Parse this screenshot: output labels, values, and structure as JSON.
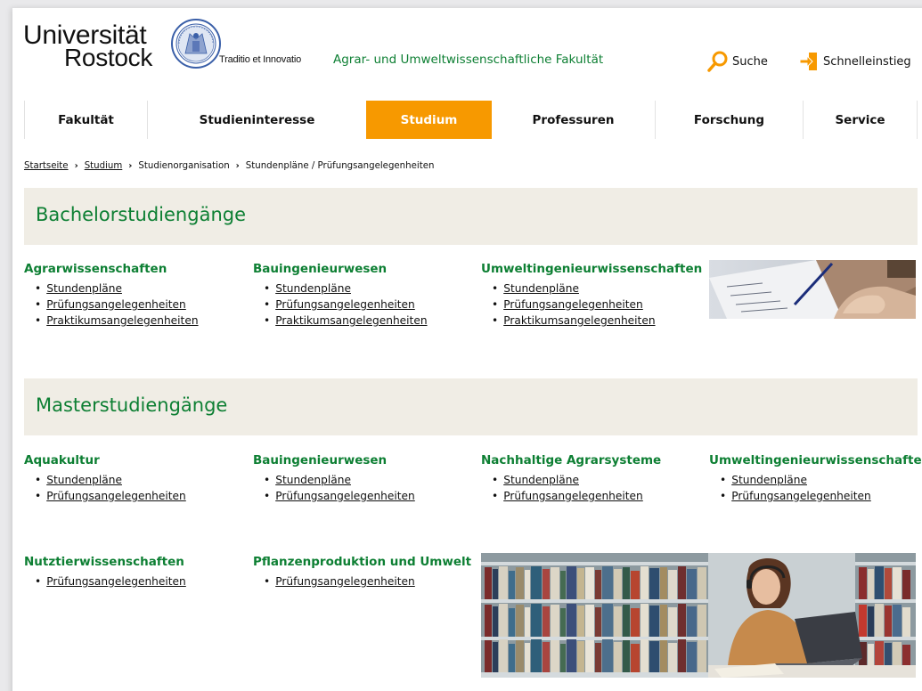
{
  "header": {
    "logo_line1": "Universität",
    "logo_line2": "Rostock",
    "motto": "Traditio et Innovatio",
    "faculty": "Agrar- und Umweltwissenschaftliche Fakultät",
    "search_label": "Suche",
    "quick_label": "Schnelleinstieg",
    "accent_color": "#f79900",
    "green_color": "#0d7f33"
  },
  "nav": {
    "items": [
      {
        "label": "Fakultät"
      },
      {
        "label": "Studieninteresse"
      },
      {
        "label": "Studium",
        "active": true
      },
      {
        "label": "Professuren"
      },
      {
        "label": "Forschung"
      },
      {
        "label": "Service"
      }
    ]
  },
  "breadcrumb": {
    "items": [
      "Startseite",
      "Studium",
      "Studienorganisation",
      "Stundenpläne / Prüfungsangelegenheiten"
    ]
  },
  "bachelor": {
    "title": "Bachelorstudiengänge",
    "columns": [
      {
        "title": "Agrarwissenschaften",
        "links": [
          "Stundenpläne",
          "Prüfungsangelegenheiten",
          "Praktikumsangelegenheiten"
        ]
      },
      {
        "title": "Bauingenieurwesen",
        "links": [
          "Stundenpläne",
          "Prüfungsangelegenheiten",
          "Praktikumsangelegenheiten"
        ]
      },
      {
        "title": "Umweltingenieurwissenschaften",
        "links": [
          "Stundenpläne",
          "Prüfungsangelegenheiten",
          "Praktikumsangelegenheiten"
        ]
      }
    ]
  },
  "master": {
    "title": "Masterstudiengänge",
    "columns": [
      {
        "title": "Aquakultur",
        "links": [
          "Stundenpläne",
          "Prüfungsangelegenheiten"
        ]
      },
      {
        "title": "Bauingenieurwesen",
        "links": [
          "Stundenpläne",
          "Prüfungsangelegenheiten"
        ]
      },
      {
        "title": "Nachhaltige Agrarsysteme",
        "links": [
          "Stundenpläne",
          "Prüfungsangelegenheiten"
        ]
      },
      {
        "title": "Umweltingenieurwissenschaften",
        "links": [
          "Stundenpläne",
          "Prüfungsangelegenheiten"
        ]
      },
      {
        "title": "Nutztierwissenschaften",
        "links": [
          "Prüfungsangelegenheiten"
        ]
      },
      {
        "title": "Pflanzenproduktion und Umwelt",
        "links": [
          "Prüfungsangelegenheiten"
        ]
      }
    ]
  },
  "icons": {
    "search": "search-icon",
    "quick": "quick-access-icon",
    "seal": "university-seal-icon"
  }
}
